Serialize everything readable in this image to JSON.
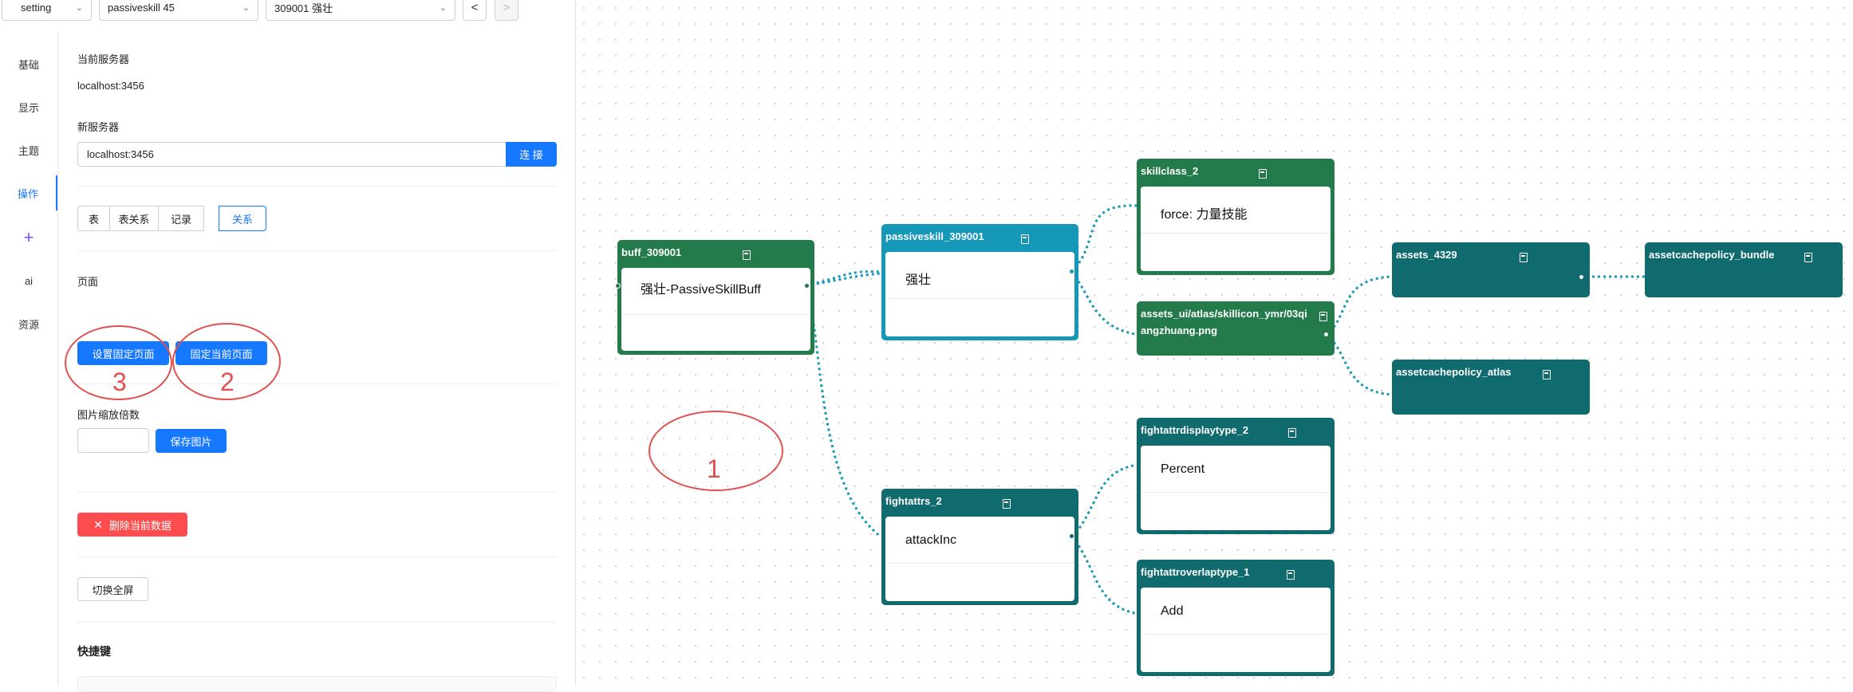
{
  "top_bar": {
    "mode_select": "setting",
    "table_select": "passiveskill 45",
    "record_select": "309001 强壮",
    "prev_button": "<",
    "next_button": ">"
  },
  "sidebar": {
    "items": [
      {
        "label": "基础"
      },
      {
        "label": "显示"
      },
      {
        "label": "主题"
      },
      {
        "label": "操作",
        "active": true
      },
      {
        "label": "+",
        "icon": "plus-icon"
      },
      {
        "label": "ai"
      },
      {
        "label": "资源"
      }
    ]
  },
  "settings": {
    "current_server_label": "当前服务器",
    "current_server_value": "localhost:3456",
    "new_server_label": "新服务器",
    "new_server_value": "localhost:3456",
    "connect_button": "连 接",
    "segments": [
      "表",
      "表关系",
      "记录",
      "关系"
    ],
    "active_segment": "关系",
    "page_label": "页面",
    "set_fixed_page_button": "设置固定页面",
    "fix_current_page_button": "固定当前页面",
    "image_scale_label": "图片缩放倍数",
    "image_scale_value": "",
    "save_image_button": "保存图片",
    "delete_data_button": "删除当前数据",
    "delete_icon": "close-icon",
    "fullscreen_button": "切换全屏",
    "shortcuts_label": "快捷键"
  },
  "annotations": [
    {
      "number": "1"
    },
    {
      "number": "2"
    },
    {
      "number": "3"
    }
  ],
  "graph": {
    "nodes": {
      "buff": {
        "title": "buff_309001",
        "value": "强壮-PassiveSkillBuff",
        "color": "#237a4b"
      },
      "passiveskill": {
        "title": "passiveskill_309001",
        "value": "强壮",
        "color": "#1597b8"
      },
      "skillclass": {
        "title": "skillclass_2",
        "value": "force: 力量技能",
        "color": "#237a4b"
      },
      "assets_ui": {
        "title": "assets_ui/atlas/skillicon_ymr/03qi",
        "title2": "angzhuang.png",
        "color": "#237a4b"
      },
      "assets_4329": {
        "title": "assets_4329",
        "color": "#0f6b6e"
      },
      "assetcachepolicy_bundle": {
        "title": "assetcachepolicy_bundle",
        "color": "#0f6b6e"
      },
      "assetcachepolicy_atlas": {
        "title": "assetcachepolicy_atlas",
        "color": "#0f6b6e"
      },
      "fightattrs": {
        "title": "fightattrs_2",
        "value": "attackInc",
        "color": "#0f6b6e"
      },
      "fightattrdisplaytype": {
        "title": "fightattrdisplaytype_2",
        "value": "Percent",
        "color": "#0f6b6e"
      },
      "fightattroverlaptype": {
        "title": "fightattroverlaptype_1",
        "value": "Add",
        "color": "#0f6b6e"
      }
    }
  },
  "colors": {
    "primary": "#1677ff",
    "danger": "#ff4d4f",
    "annotation": "#e05050",
    "edge": "#1597b8"
  }
}
